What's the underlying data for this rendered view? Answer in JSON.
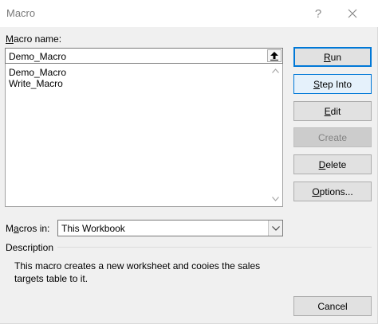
{
  "window": {
    "title": "Macro",
    "help_label": "?"
  },
  "macro_name": {
    "label_accel": "M",
    "label_rest": "acro name:",
    "value": "Demo_Macro"
  },
  "macros": [
    {
      "label": "Demo_Macro"
    },
    {
      "label": "Write_Macro"
    }
  ],
  "macros_in": {
    "label_pre": "M",
    "label_accel": "a",
    "label_rest": "cros in:",
    "value": "This Workbook"
  },
  "description": {
    "label": "Description",
    "text": "This macro creates a new worksheet and cooies the sales targets table to it."
  },
  "buttons": {
    "run": {
      "accel": "R",
      "rest": "un"
    },
    "step_into": {
      "accel": "S",
      "rest": "tep Into"
    },
    "edit": {
      "accel": "E",
      "rest": "dit"
    },
    "create": {
      "accel": "",
      "rest": "Create"
    },
    "delete": {
      "accel": "D",
      "rest": "elete"
    },
    "options": {
      "accel": "O",
      "rest": "ptions..."
    },
    "cancel": {
      "accel": "",
      "rest": "Cancel"
    }
  },
  "icons": {
    "help": "question-mark",
    "close": "close-x",
    "upload": "upload-arrow",
    "scroll_up": "chevron-up",
    "scroll_down": "chevron-down",
    "dropdown": "chevron-down"
  },
  "colors": {
    "accent": "#0078d7",
    "hover_fill": "#e5f1fb",
    "disabled_text": "#838383"
  }
}
